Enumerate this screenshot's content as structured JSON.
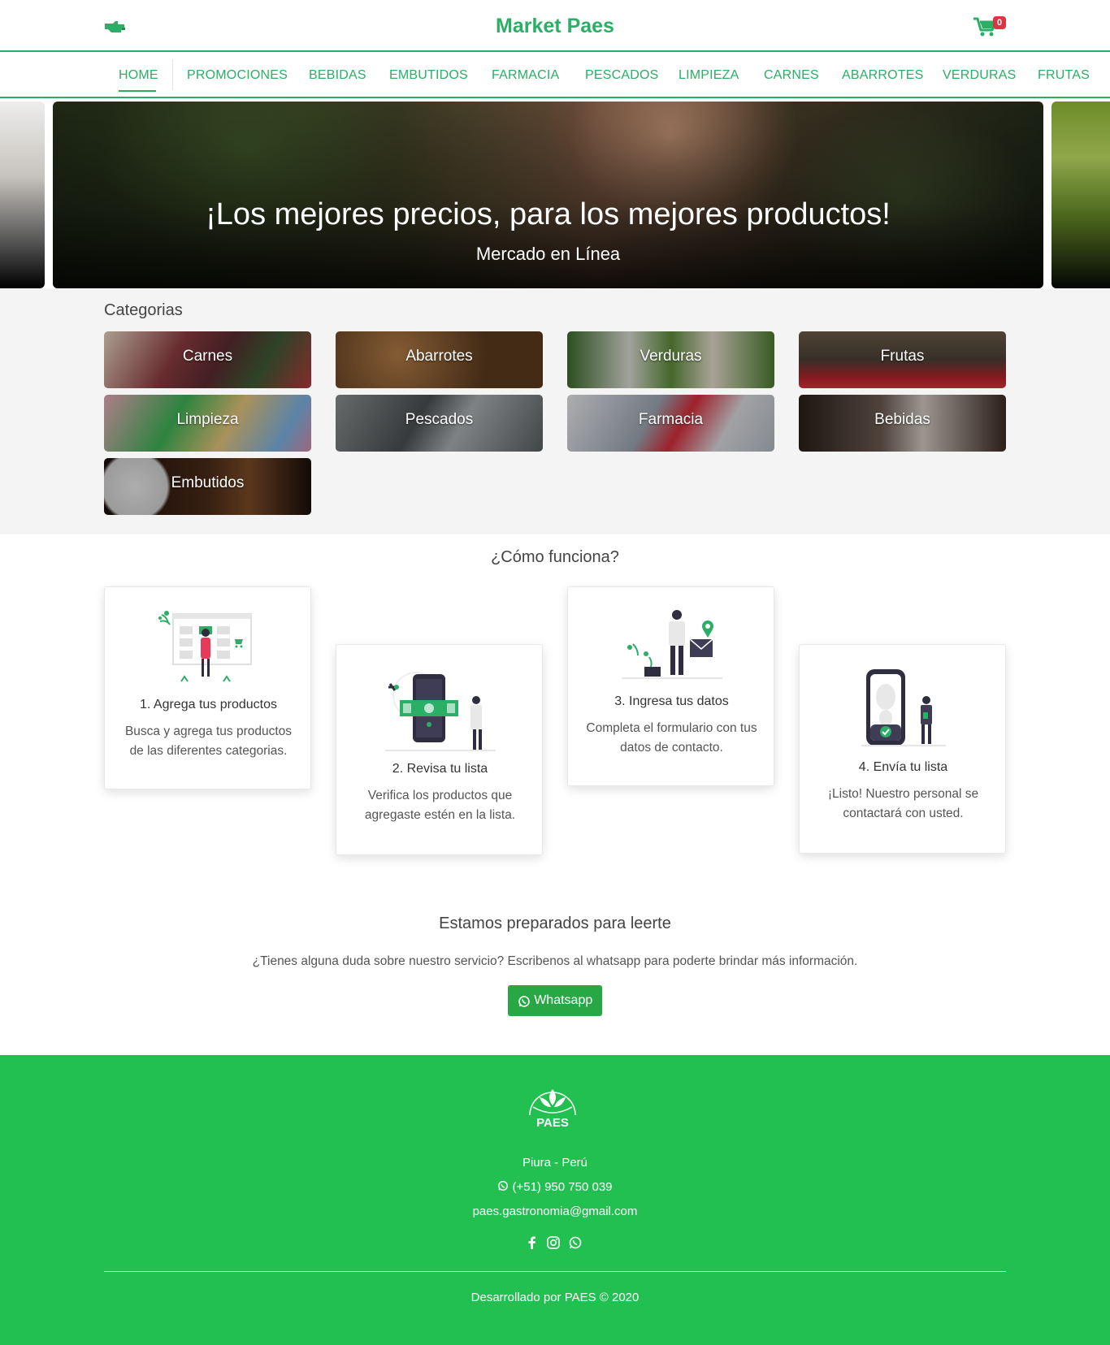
{
  "header": {
    "brand": "Market Paes",
    "cart_count": "0"
  },
  "nav": {
    "items": [
      "HOME",
      "PROMOCIONES",
      "BEBIDAS",
      "EMBUTIDOS",
      "FARMACIA",
      "PESCADOS",
      "LIMPIEZA",
      "CARNES",
      "ABARROTES",
      "VERDURAS",
      "FRUTAS"
    ],
    "active": "HOME"
  },
  "hero": {
    "title": "¡Los mejores precios, para los mejores productos!",
    "subtitle": "Mercado en Línea"
  },
  "categories": {
    "heading": "Categorias",
    "items": [
      "Carnes",
      "Abarrotes",
      "Verduras",
      "Frutas",
      "Limpieza",
      "Pescados",
      "Farmacia",
      "Bebidas",
      "Embutidos"
    ]
  },
  "how": {
    "title": "¿Cómo funciona?",
    "steps": [
      {
        "title": "1. Agrega tus productos",
        "desc": "Busca y agrega tus productos de las diferentes categorias."
      },
      {
        "title": "2. Revisa tu lista",
        "desc": "Verifica los productos que agregaste estén en la lista."
      },
      {
        "title": "3. Ingresa tus datos",
        "desc": "Completa el formulario con tus datos de contacto."
      },
      {
        "title": "4. Envía tu lista",
        "desc": "¡Listo! Nuestro personal se contactará con usted."
      }
    ]
  },
  "contact": {
    "title": "Estamos preparados para leerte",
    "text": "¿Tienes alguna duda sobre nuestro servicio? Escribenos al whatsapp para poderte brindar más información.",
    "button": "Whatsapp"
  },
  "footer": {
    "logo_text": "PAES",
    "location": "Piura - Perú",
    "phone": "(+51) 950 750 039",
    "email": "paes.gastronomia@gmail.com",
    "copyright": "Desarrollado por PAES © 2020"
  },
  "colors": {
    "brand_green": "#2bae66",
    "footer_green": "#22c050",
    "button_green": "#28a745",
    "badge_red": "#dc3545"
  },
  "icons": [
    "hand-pointer-icon",
    "shopping-cart-icon",
    "whatsapp-icon",
    "facebook-icon",
    "instagram-icon"
  ]
}
